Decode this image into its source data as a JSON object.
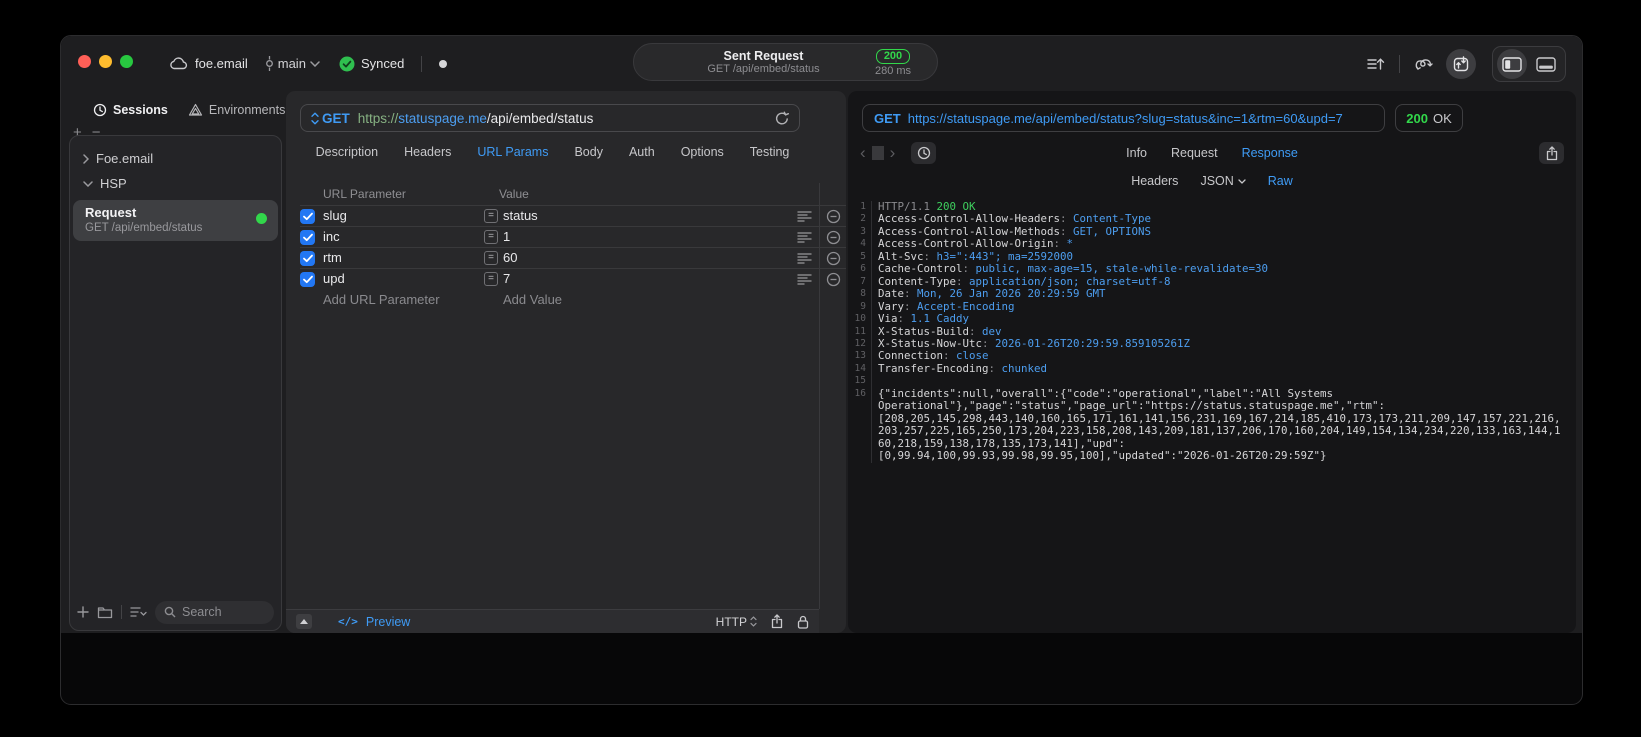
{
  "titlebar": {
    "project": "foe.email",
    "branch": "main",
    "synced": "Synced",
    "request": {
      "title": "Sent Request",
      "subtitle": "GET /api/embed/status",
      "status_code": "200",
      "duration": "280 ms"
    }
  },
  "sidebar": {
    "tabs": [
      {
        "label": "Sessions"
      },
      {
        "label": "Environments"
      }
    ],
    "tree": [
      {
        "label": "Foe.email"
      },
      {
        "label": "HSP"
      }
    ],
    "request_item": {
      "title": "Request",
      "subtitle": "GET /api/embed/status"
    },
    "search_placeholder": "Search"
  },
  "request_editor": {
    "method": "GET",
    "url_scheme": "https://",
    "url_host": "statuspage.me",
    "url_path": "/api/embed/status",
    "tabs": [
      "Description",
      "Headers",
      "URL Params",
      "Body",
      "Auth",
      "Options",
      "Testing"
    ],
    "active_tab": "URL Params",
    "params": {
      "col_name": "URL Parameter",
      "col_value": "Value",
      "equals_glyph": "=",
      "rows": [
        {
          "name": "slug",
          "value": "status",
          "checked": true
        },
        {
          "name": "inc",
          "value": "1",
          "checked": true
        },
        {
          "name": "rtm",
          "value": "60",
          "checked": true
        },
        {
          "name": "upd",
          "value": "7",
          "checked": true
        }
      ],
      "add_name": "Add URL Parameter",
      "add_value": "Add Value"
    },
    "footer": {
      "code_glyph": "</>",
      "preview": "Preview",
      "protocol": "HTTP"
    }
  },
  "response_viewer": {
    "method": "GET",
    "url": "https://statuspage.me/api/embed/status?slug=status&inc=1&rtm=60&upd=7",
    "status_code": "200",
    "status_text": "OK",
    "tabs": [
      "Info",
      "Request",
      "Response"
    ],
    "active_tab": "Response",
    "subtabs": [
      "Headers",
      "JSON",
      "Raw"
    ],
    "active_subtab": "Raw",
    "code_lines": [
      {
        "n": "1",
        "segs": [
          [
            "HTTP/1.1 ",
            "dim"
          ],
          [
            "200 OK",
            "green"
          ]
        ]
      },
      {
        "n": "2",
        "segs": [
          [
            "Access-Control-Allow-Headers",
            "key"
          ],
          [
            ": ",
            "dim"
          ],
          [
            "Content-Type",
            "val"
          ]
        ]
      },
      {
        "n": "3",
        "segs": [
          [
            "Access-Control-Allow-Methods",
            "key"
          ],
          [
            ": ",
            "dim"
          ],
          [
            "GET, OPTIONS",
            "val"
          ]
        ]
      },
      {
        "n": "4",
        "segs": [
          [
            "Access-Control-Allow-Origin",
            "key"
          ],
          [
            ": ",
            "dim"
          ],
          [
            "*",
            "val"
          ]
        ]
      },
      {
        "n": "5",
        "segs": [
          [
            "Alt-Svc",
            "key"
          ],
          [
            ": ",
            "dim"
          ],
          [
            "h3=\":443\"; ma=2592000",
            "val"
          ]
        ]
      },
      {
        "n": "6",
        "segs": [
          [
            "Cache-Control",
            "key"
          ],
          [
            ": ",
            "dim"
          ],
          [
            "public, max-age=15, stale-while-revalidate=30",
            "val"
          ]
        ]
      },
      {
        "n": "7",
        "segs": [
          [
            "Content-Type",
            "key"
          ],
          [
            ": ",
            "dim"
          ],
          [
            "application/json; charset=utf-8",
            "val"
          ]
        ]
      },
      {
        "n": "8",
        "segs": [
          [
            "Date",
            "key"
          ],
          [
            ": ",
            "dim"
          ],
          [
            "Mon, 26 Jan 2026 20:29:59 GMT",
            "val"
          ]
        ]
      },
      {
        "n": "9",
        "segs": [
          [
            "Vary",
            "key"
          ],
          [
            ": ",
            "dim"
          ],
          [
            "Accept-Encoding",
            "val"
          ]
        ]
      },
      {
        "n": "10",
        "segs": [
          [
            "Via",
            "key"
          ],
          [
            ": ",
            "dim"
          ],
          [
            "1.1 Caddy",
            "val"
          ]
        ]
      },
      {
        "n": "11",
        "segs": [
          [
            "X-Status-Build",
            "key"
          ],
          [
            ": ",
            "dim"
          ],
          [
            "dev",
            "val"
          ]
        ]
      },
      {
        "n": "12",
        "segs": [
          [
            "X-Status-Now-Utc",
            "key"
          ],
          [
            ": ",
            "dim"
          ],
          [
            "2026-01-26T20:29:59.859105261Z",
            "val"
          ]
        ]
      },
      {
        "n": "13",
        "segs": [
          [
            "Connection",
            "key"
          ],
          [
            ": ",
            "dim"
          ],
          [
            "close",
            "val"
          ]
        ]
      },
      {
        "n": "14",
        "segs": [
          [
            "Transfer-Encoding",
            "key"
          ],
          [
            ": ",
            "dim"
          ],
          [
            "chunked",
            "val"
          ]
        ]
      },
      {
        "n": "15",
        "segs": []
      },
      {
        "n": "16",
        "segs": [
          [
            "{\"incidents\":null,\"overall\":{\"code\":\"operational\",\"label\":\"All Systems",
            "body"
          ]
        ]
      },
      {
        "n": "",
        "segs": [
          [
            "Operational\"},\"page\":\"status\",\"page_url\":\"https://status.statuspage.me\",\"rtm\":",
            "body"
          ]
        ]
      },
      {
        "n": "",
        "segs": [
          [
            "[208,205,145,298,443,140,160,165,171,161,141,156,231,169,167,214,185,410,173,173,211,209,147,157,221,216,",
            "body"
          ]
        ]
      },
      {
        "n": "",
        "segs": [
          [
            "203,257,225,165,250,173,204,223,158,208,143,209,181,137,206,170,160,204,149,154,134,234,220,133,163,144,1",
            "body"
          ]
        ]
      },
      {
        "n": "",
        "segs": [
          [
            "60,218,159,138,178,135,173,141],\"upd\":",
            "body"
          ]
        ]
      },
      {
        "n": "",
        "segs": [
          [
            "[0,99.94,100,99.93,99.98,99.95,100],\"updated\":\"2026-01-26T20:29:59Z\"}",
            "body"
          ]
        ]
      }
    ]
  },
  "colors": {
    "accent_blue": "#3f9bf5",
    "status_green": "#32d74b"
  }
}
